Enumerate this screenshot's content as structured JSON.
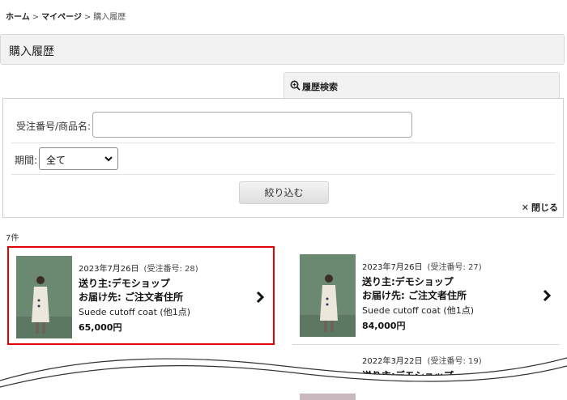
{
  "breadcrumb": {
    "home": "ホーム",
    "mypage": "マイページ",
    "current": "購入履歴",
    "separator": ">"
  },
  "page_title": "購入履歴",
  "search_tab": {
    "label": "履歴検索",
    "icon": "zoom-in-icon"
  },
  "search": {
    "order_label": "受注番号/商品名:",
    "order_value": "",
    "period_label": "期間:",
    "period_selected": "全て",
    "filter_button": "絞り込む",
    "close_label": "閉じる",
    "close_icon": "✕"
  },
  "result_count": "7件",
  "orders": [
    {
      "date": "2023年7月26日",
      "order_no": "(受注番号: 28)",
      "sender": "送り主:デモショップ",
      "destination": "お届け先: ご注文者住所",
      "product": "Suede cutoff coat (他1点)",
      "price": "65,000円"
    },
    {
      "date": "2023年7月26日",
      "order_no": "(受注番号: 27)",
      "sender": "送り主:デモショップ",
      "destination": "お届け先: ご注文者住所",
      "product": "Suede cutoff coat (他1点)",
      "price": "84,000円"
    },
    {
      "date": "2022年3月22日",
      "order_no": "(受注番号: 19)",
      "sender": "送り主:デモショップ"
    }
  ],
  "colors": {
    "highlight_border": "#e00000",
    "panel_bg": "#f2f2f2"
  }
}
